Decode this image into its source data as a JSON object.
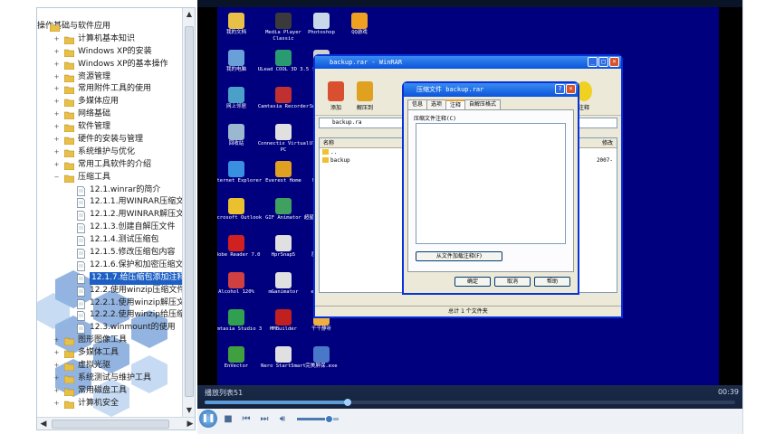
{
  "tree": {
    "root": "操作基础与软件应用",
    "items": [
      {
        "label": "计算机基本知识",
        "level": 0
      },
      {
        "label": "Windows XP的安装",
        "level": 0
      },
      {
        "label": "Windows XP的基本操作",
        "level": 0
      },
      {
        "label": "资源管理",
        "level": 0
      },
      {
        "label": "常用附件工具的使用",
        "level": 0
      },
      {
        "label": "多媒体应用",
        "level": 0
      },
      {
        "label": "网络基础",
        "level": 0
      },
      {
        "label": "软件管理",
        "level": 0
      },
      {
        "label": "硬件的安装与管理",
        "level": 0
      },
      {
        "label": "系统维护与优化",
        "level": 0
      },
      {
        "label": "常用工具软件的介绍",
        "level": 0
      },
      {
        "label": "压缩工具",
        "level": 0,
        "expanded": true
      },
      {
        "label": "12.1.winrar的简介",
        "level": 1
      },
      {
        "label": "12.1.1.用WINRAR压缩文件",
        "level": 1
      },
      {
        "label": "12.1.2.用WINRAR解压文件",
        "level": 1
      },
      {
        "label": "12.1.3.创建自解压文件",
        "level": 1
      },
      {
        "label": "12.1.4.测试压缩包",
        "level": 1
      },
      {
        "label": "12.1.5.修改压缩包内容",
        "level": 1
      },
      {
        "label": "12.1.6.保护和加密压缩文",
        "level": 1
      },
      {
        "label": "12.1.7.给压缩包添加注释",
        "level": 1,
        "selected": true
      },
      {
        "label": "12.2.使用winzip压缩文件",
        "level": 1
      },
      {
        "label": "12.2.1.使用winzip解压文",
        "level": 1
      },
      {
        "label": "12.2.2.使用winzip给压缩",
        "level": 1
      },
      {
        "label": "12.3.winmount的使用",
        "level": 1
      },
      {
        "label": "图形图像工具",
        "level": 0
      },
      {
        "label": "多媒体工具",
        "level": 0
      },
      {
        "label": "虚拟光驱",
        "level": 0
      },
      {
        "label": "系统测试与维护工具",
        "level": 0
      },
      {
        "label": "常用磁盘工具",
        "level": 0
      },
      {
        "label": "计算机安全",
        "level": 0
      }
    ]
  },
  "desktop": {
    "icons": [
      {
        "label": "我的文档",
        "color": "#e8c048"
      },
      {
        "label": "Media Player Classic",
        "color": "#3a3a3a"
      },
      {
        "label": "Photoshop",
        "color": "#c8d8e8"
      },
      {
        "label": "QQ游戏",
        "color": "#f0a020"
      },
      {
        "label": "我的电脑",
        "color": "#6aa0d8"
      },
      {
        "label": "ULead COOL 3D 3.5",
        "color": "#2a9a70"
      },
      {
        "label": "Scrpen",
        "color": "#d0d0d0"
      },
      {
        "label": "网上邻居",
        "color": "#4aa0c8"
      },
      {
        "label": "Camtasia Recorder",
        "color": "#c03030"
      },
      {
        "label": "SnagIt32",
        "color": "#e0e0e0"
      },
      {
        "label": "回收站",
        "color": "#9ab8d0"
      },
      {
        "label": "Connectix Virtual PC",
        "color": "#e0e0e0"
      },
      {
        "label": "UltraISO",
        "color": "#a0a0d8"
      },
      {
        "label": "Internet Explorer",
        "color": "#3a90e0"
      },
      {
        "label": "Everest Home",
        "color": "#e0a020"
      },
      {
        "label": "WinRAR",
        "color": "#b04090"
      },
      {
        "label": "Microsoft Outlook",
        "color": "#e8c030"
      },
      {
        "label": "GIF Animator",
        "color": "#40a060"
      },
      {
        "label": "超星数字图书馆",
        "color": "#d04020"
      },
      {
        "label": "Adobe Reader 7.0",
        "color": "#d02020"
      },
      {
        "label": "HprSnap5",
        "color": "#e0e0e0"
      },
      {
        "label": "屏录专家",
        "color": "#d0d0d0"
      },
      {
        "label": "Alcohol 120%",
        "color": "#d04040"
      },
      {
        "label": "mGanimator",
        "color": "#e0e0e0"
      },
      {
        "label": "everest",
        "color": "#e0a020"
      },
      {
        "label": "Camtasia Studio 3",
        "color": "#30a050"
      },
      {
        "label": "MMBuilder",
        "color": "#c02020"
      },
      {
        "label": "千千静听",
        "color": "#f0b040"
      },
      {
        "label": "EnVector",
        "color": "#40a040"
      },
      {
        "label": "Nero StartSmart",
        "color": "#e0e0e0"
      },
      {
        "label": "完美屏保.exe",
        "color": "#4a78c8"
      }
    ]
  },
  "winrar": {
    "title": "backup.rar - WinRAR",
    "tools": [
      {
        "label": "添加",
        "color": "#d85030"
      },
      {
        "label": "解压到",
        "color": "#e0a020"
      },
      {
        "label": "注释",
        "color": "#3a90e0"
      }
    ],
    "address": "backup.ra",
    "columns": [
      "名称",
      "修改"
    ],
    "rows": [
      {
        "name": ".."
      },
      {
        "name": "backup",
        "meta": "夹",
        "date": "2007-"
      }
    ],
    "status": "总计 1 个文件夹"
  },
  "dialog": {
    "title": "压缩文件 backup.rar",
    "tabs": [
      "信息",
      "选项",
      "注释",
      "自解压格式"
    ],
    "active_tab": "注释",
    "comment_label": "压缩文件注释(C)",
    "load_button": "从文件加载注释(F)",
    "ok": "确定",
    "cancel": "取消",
    "help": "帮助"
  },
  "player": {
    "playlist": "播放列表51",
    "time": "00:39",
    "seek_fraction": 0.27,
    "volume_fraction": 0.75
  }
}
